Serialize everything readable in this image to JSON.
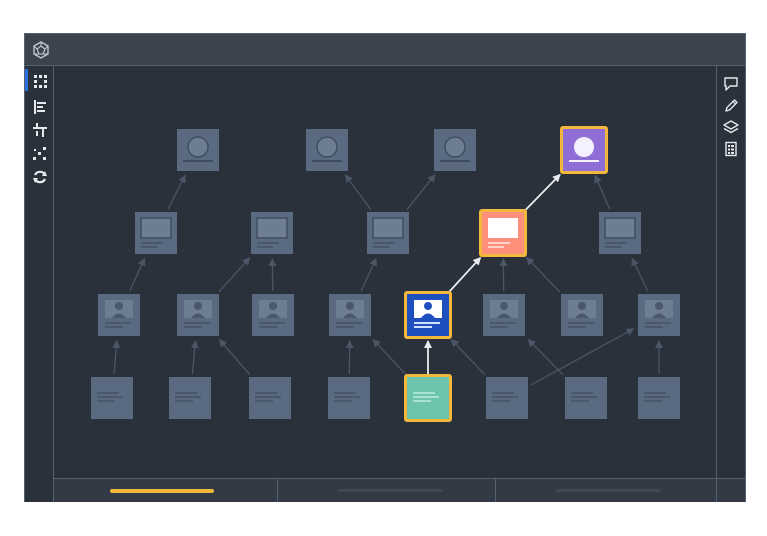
{
  "window": {
    "logo_icon": "polyhedron-icon"
  },
  "left_toolbar": [
    {
      "name": "grid-icon",
      "active": true
    },
    {
      "name": "align-left-icon",
      "active": false
    },
    {
      "name": "hierarchy-icon",
      "active": false
    },
    {
      "name": "scatter-nodes-icon",
      "active": false
    },
    {
      "name": "cycle-icon",
      "active": false
    }
  ],
  "right_toolbar": [
    "comment-icon",
    "pencil-icon",
    "layers-icon",
    "notebook-icon"
  ],
  "graph": {
    "rows": [
      {
        "node_type": "circle-card",
        "count": 4
      },
      {
        "node_type": "screen-card",
        "count": 5
      },
      {
        "node_type": "profile-card",
        "count": 8
      },
      {
        "node_type": "document-card",
        "count": 8
      }
    ],
    "highlighted_path": [
      {
        "row": 3,
        "index": 4,
        "color": "#6cc5aa"
      },
      {
        "row": 2,
        "index": 4,
        "color": "#1f4fbf"
      },
      {
        "row": 1,
        "index": 3,
        "color": "#ff8f7a"
      },
      {
        "row": 0,
        "index": 3,
        "color": "#8f6fd6"
      }
    ],
    "highlight_border": "#f3b73c",
    "node_color": "#5a6a80",
    "edge_color": "#4a5666",
    "path_edge_color": "#e8ecf0"
  },
  "bottom_tabs": [
    {
      "name": "tab-1",
      "active": true,
      "accent": "#f3b73c"
    },
    {
      "name": "tab-2",
      "active": false
    },
    {
      "name": "tab-3",
      "active": false
    }
  ]
}
